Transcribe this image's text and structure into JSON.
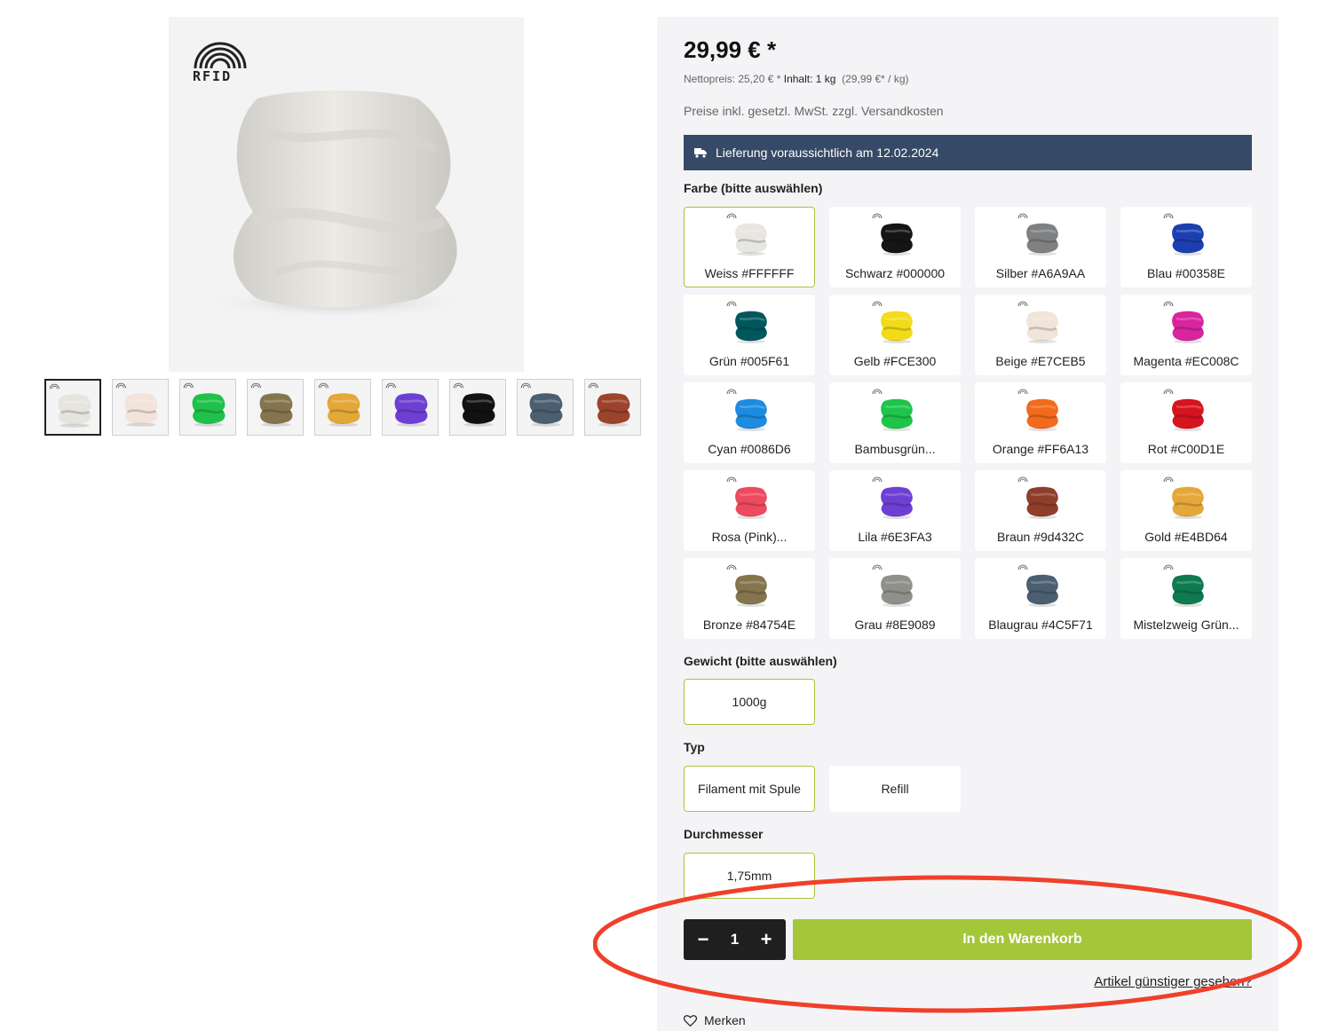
{
  "gallery": {
    "logo_text": "RFID",
    "main_color": "#FFFFFF",
    "thumbnails": [
      {
        "color": "#E6E4DF",
        "icon": "vase-thumbnail"
      },
      {
        "color": "#F2E4DA",
        "icon": "vase-thumbnail"
      },
      {
        "color": "#1FC14A",
        "icon": "vase-thumbnail"
      },
      {
        "color": "#84754E",
        "icon": "vase-thumbnail"
      },
      {
        "color": "#E4A83A",
        "icon": "vase-thumbnail"
      },
      {
        "color": "#6E3FD3",
        "icon": "vase-thumbnail"
      },
      {
        "color": "#111111",
        "icon": "vase-thumbnail"
      },
      {
        "color": "#4C5F71",
        "icon": "vase-thumbnail"
      },
      {
        "color": "#9D432C",
        "icon": "vase-thumbnail"
      }
    ],
    "active_thumbnail": 0
  },
  "buybox": {
    "price": "29,99 € *",
    "net_price": "Nettopreis: 25,20 € *",
    "content": "Inhalt: 1 kg",
    "unit_price": "(29,99 €* / kg)",
    "tax_note": "Preise inkl. gesetzl. MwSt. zzgl. Versandkosten",
    "delivery": "Lieferung voraussichtlich am 12.02.2024",
    "delivery_bg": "#364966",
    "color_label": "Farbe (bitte auswählen)",
    "colors": [
      {
        "label": "Weiss #FFFFFF",
        "hex": "#E8E6E1",
        "selected": true
      },
      {
        "label": "Schwarz #000000",
        "hex": "#151515",
        "selected": false
      },
      {
        "label": "Silber #A6A9AA",
        "hex": "#7E8082",
        "selected": false
      },
      {
        "label": "Blau #00358E",
        "hex": "#1C3FB0",
        "selected": false
      },
      {
        "label": "Grün #005F61",
        "hex": "#00575C",
        "selected": false
      },
      {
        "label": "Gelb #FCE300",
        "hex": "#F3DB18",
        "selected": false
      },
      {
        "label": "Beige #E7CEB5",
        "hex": "#F1E4D8",
        "selected": false
      },
      {
        "label": "Magenta #EC008C",
        "hex": "#D8259E",
        "selected": false
      },
      {
        "label": "Cyan #0086D6",
        "hex": "#1D8BE0",
        "selected": false
      },
      {
        "label": "Bambusgrün...",
        "hex": "#1FC44A",
        "selected": false
      },
      {
        "label": "Orange #FF6A13",
        "hex": "#F26A1C",
        "selected": false
      },
      {
        "label": "Rot #C00D1E",
        "hex": "#D6141F",
        "selected": false
      },
      {
        "label": "Rosa (Pink)...",
        "hex": "#EE4A5F",
        "selected": false
      },
      {
        "label": "Lila #6E3FA3",
        "hex": "#6E3FD3",
        "selected": false
      },
      {
        "label": "Braun #9d432C",
        "hex": "#8F3E2C",
        "selected": false
      },
      {
        "label": "Gold #E4BD64",
        "hex": "#E4A83A",
        "selected": false
      },
      {
        "label": "Bronze #84754E",
        "hex": "#84754E",
        "selected": false
      },
      {
        "label": "Grau #8E9089",
        "hex": "#8E9089",
        "selected": false
      },
      {
        "label": "Blaugrau #4C5F71",
        "hex": "#4C5F71",
        "selected": false
      },
      {
        "label": "Mistelzweig Grün...",
        "hex": "#0F7A4F",
        "selected": false
      }
    ],
    "weight_label": "Gewicht (bitte auswählen)",
    "weight_options": [
      {
        "label": "1000g",
        "selected": true
      }
    ],
    "type_label": "Typ",
    "type_options": [
      {
        "label": "Filament mit Spule",
        "selected": true
      },
      {
        "label": "Refill",
        "selected": false
      }
    ],
    "diameter_label": "Durchmesser",
    "diameter_options": [
      {
        "label": "1,75mm",
        "selected": true
      }
    ],
    "quantity": "1",
    "minus_symbol": "−",
    "plus_symbol": "+",
    "add_to_cart": "In den Warenkorb",
    "add_to_cart_color": "#A4C639",
    "cheaper_link": "Artikel günstiger gesehen?",
    "wishlist": "Merken"
  },
  "annotation": {
    "shape": "ellipse",
    "color": "#F0402A"
  }
}
